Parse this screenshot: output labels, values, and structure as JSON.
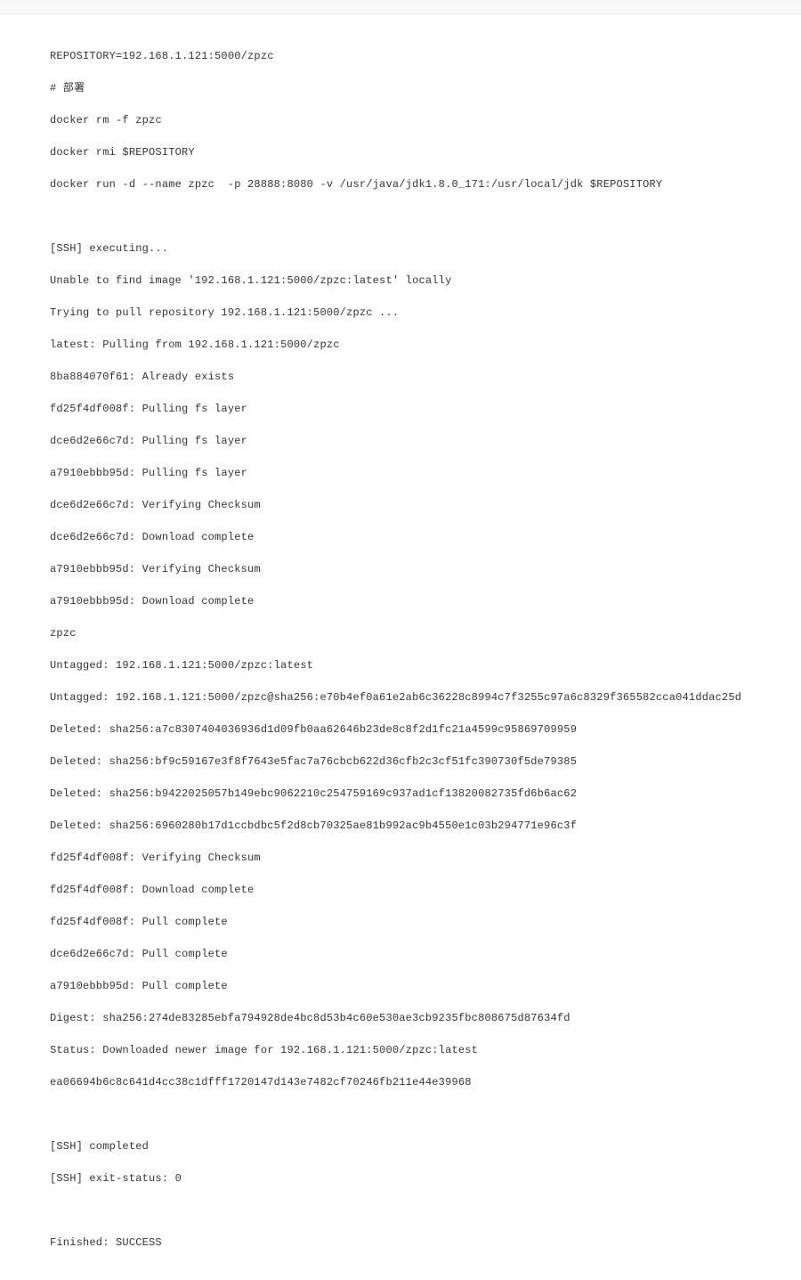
{
  "console": {
    "lines": [
      "REPOSITORY=192.168.1.121:5000/zpzc",
      "# 部署",
      "docker rm -f zpzc",
      "docker rmi $REPOSITORY",
      "docker run -d --name zpzc  -p 28888:8080 -v /usr/java/jdk1.8.0_171:/usr/local/jdk $REPOSITORY",
      "",
      "[SSH] executing...",
      "Unable to find image '192.168.1.121:5000/zpzc:latest' locally",
      "Trying to pull repository 192.168.1.121:5000/zpzc ...",
      "latest: Pulling from 192.168.1.121:5000/zpzc",
      "8ba884070f61: Already exists",
      "fd25f4df008f: Pulling fs layer",
      "dce6d2e66c7d: Pulling fs layer",
      "a7910ebbb95d: Pulling fs layer",
      "dce6d2e66c7d: Verifying Checksum",
      "dce6d2e66c7d: Download complete",
      "a7910ebbb95d: Verifying Checksum",
      "a7910ebbb95d: Download complete",
      "zpzc",
      "Untagged: 192.168.1.121:5000/zpzc:latest",
      "Untagged: 192.168.1.121:5000/zpzc@sha256:e70b4ef0a61e2ab6c36228c8994c7f3255c97a6c8329f365582cca041ddac25d",
      "Deleted: sha256:a7c8307404036936d1d09fb0aa62646b23de8c8f2d1fc21a4599c95869709959",
      "Deleted: sha256:bf9c59167e3f8f7643e5fac7a76cbcb622d36cfb2c3cf51fc390730f5de79385",
      "Deleted: sha256:b9422025057b149ebc9062210c254759169c937ad1cf13820082735fd6b6ac62",
      "Deleted: sha256:6960280b17d1ccbdbc5f2d8cb70325ae81b992ac9b4550e1c03b294771e96c3f",
      "fd25f4df008f: Verifying Checksum",
      "fd25f4df008f: Download complete",
      "fd25f4df008f: Pull complete",
      "dce6d2e66c7d: Pull complete",
      "a7910ebbb95d: Pull complete",
      "Digest: sha256:274de83285ebfa794928de4bc8d53b4c60e530ae3cb9235fbc808675d87634fd",
      "Status: Downloaded newer image for 192.168.1.121:5000/zpzc:latest",
      "ea06694b6c8c641d4cc38c1dfff1720147d143e7482cf70246fb211e44e39968",
      "",
      "[SSH] completed",
      "[SSH] exit-status: 0",
      "",
      "Finished: SUCCESS"
    ]
  }
}
